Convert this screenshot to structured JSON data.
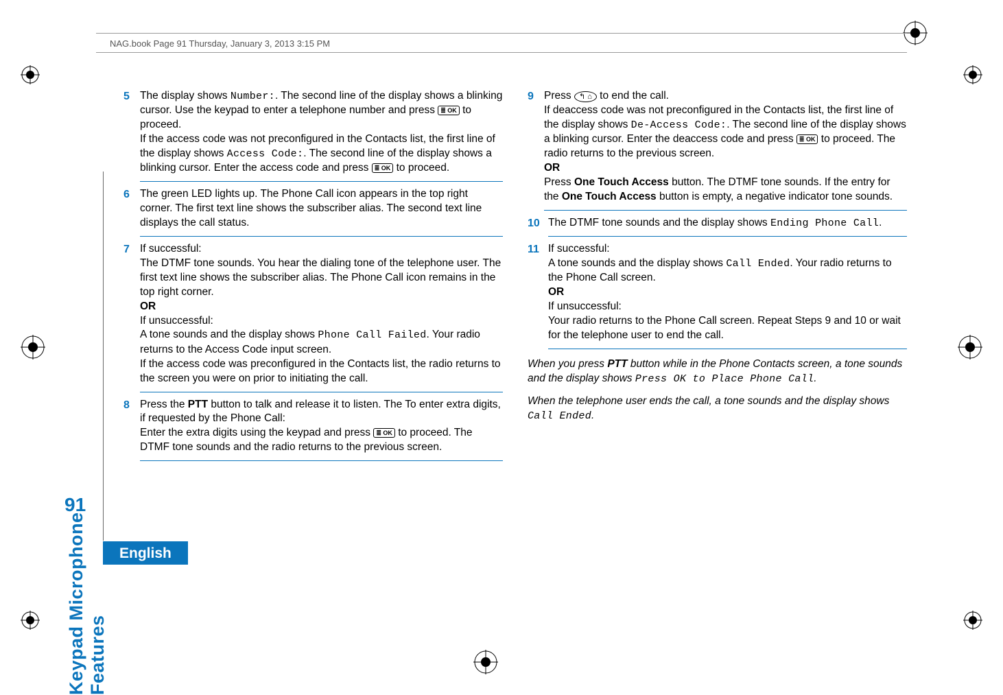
{
  "header": {
    "running": "NAG.book  Page 91  Thursday, January 3, 2013  3:15 PM"
  },
  "sidebar": {
    "section": "Keypad Microphone Features",
    "pagenum": "91",
    "language": "English"
  },
  "icons": {
    "ok": "≣ OK",
    "end": "↰ ⌂"
  },
  "leftCol": {
    "step5": {
      "num": "5",
      "t1": "The display shows ",
      "mono1": "Number:",
      "t2": ". The second line of the display shows a blinking cursor. Use the keypad to enter a telephone number and press ",
      "t3": " to proceed.",
      "t4": "If the access code was not preconfigured in the Contacts list, the first line of the display shows ",
      "mono2": "Access Code:",
      "t5": ". The second line of the display shows a blinking cursor. Enter the access code and press ",
      "t6": " to proceed."
    },
    "step6": {
      "num": "6",
      "t1": "The green LED lights up. The Phone Call icon appears in the top right corner. The first text line shows the subscriber alias. The second text line displays the call status."
    },
    "step7": {
      "num": "7",
      "t1": "If successful:",
      "t2": "The DTMF tone sounds. You hear the dialing tone of the telephone user. The first text line shows the subscriber alias. The Phone Call icon remains in the top right corner.",
      "or": "OR",
      "t3": "If unsuccessful:",
      "t4": "A tone sounds and the display shows ",
      "mono1": "Phone Call Failed",
      "t5": ". Your radio returns to the Access Code input screen.",
      "t6": "If the access code was preconfigured in the Contacts list, the radio returns to the screen you were on prior to initiating the call."
    },
    "step8": {
      "num": "8",
      "t1a": "Press the ",
      "ptt": "PTT",
      "t1b": " button to talk and release it to listen. The To enter extra digits, if requested by the Phone Call:",
      "t2": "Enter the extra digits using the keypad and press ",
      "t3": " to proceed. The DTMF tone sounds and the radio returns to the previous screen."
    }
  },
  "rightCol": {
    "step9": {
      "num": "9",
      "t1": "Press ",
      "t2": " to end the call.",
      "t3": "If deaccess code was not preconfigured in the Contacts list, the first line of the display shows ",
      "mono1": "De-Access Code:",
      "t4": ". The second line of the display shows a blinking cursor. Enter the deaccess code and press ",
      "t5": " to proceed. The radio returns to the previous screen.",
      "or": "OR",
      "t6": "Press ",
      "btn1": "One Touch Access",
      "t7": " button. The DTMF tone sounds. If the entry for the ",
      "btn2": "One Touch Access",
      "t8": " button is empty, a negative indicator tone sounds."
    },
    "step10": {
      "num": "10",
      "t1": "The DTMF tone sounds and the display shows ",
      "mono1": "Ending Phone Call",
      "t2": "."
    },
    "step11": {
      "num": "11",
      "t1": "If successful:",
      "t2": "A tone sounds and the display shows ",
      "mono1": "Call Ended",
      "t3": ". Your radio returns to the Phone Call screen.",
      "or": "OR",
      "t4": "If unsuccessful:",
      "t5": "Your radio returns to the Phone Call screen. Repeat Steps 9 and 10 or wait for the telephone user to end the call."
    },
    "italic1": {
      "t1": "When you press ",
      "ptt": "PTT",
      "t2": " button while in the Phone Contacts screen, a tone sounds and the display shows ",
      "mono1": "Press OK to Place Phone Call",
      "t3": "."
    },
    "italic2": {
      "t1": "When the telephone user ends the call, a tone sounds and the display shows ",
      "mono1": "Call Ended",
      "t2": "."
    }
  }
}
